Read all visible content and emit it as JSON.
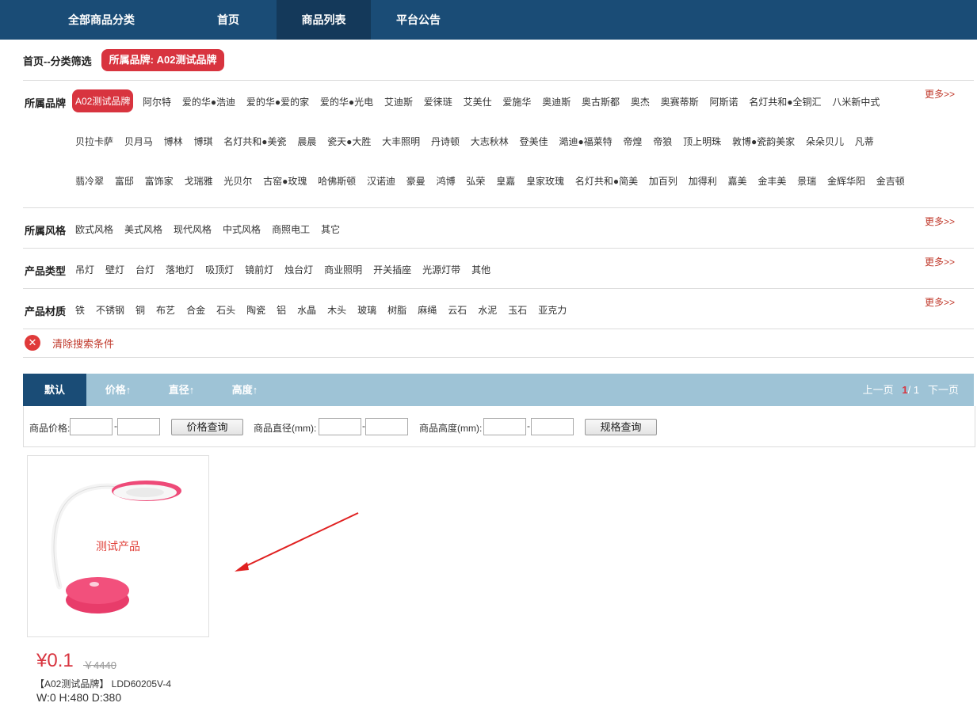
{
  "nav": {
    "items": [
      "全部商品分类",
      "首页",
      "商品列表",
      "平台公告"
    ],
    "active_index": 2
  },
  "breadcrumb": {
    "text": "首页--分类筛选",
    "tag": "所属品牌: A02测试品牌"
  },
  "filters": {
    "brand": {
      "label": "所属品牌",
      "selected": "A02测试品牌",
      "rows": [
        [
          "阿尔特",
          "爱的华●浩迪",
          "爱的华●爱的家",
          "爱的华●光电",
          "艾迪斯",
          "爱徕琏",
          "艾美仕",
          "爱施华",
          "奥迪斯",
          "奥古斯都",
          "奥杰",
          "奥赛蒂斯",
          "阿斯诺",
          "名灯共和●全铜汇",
          "八米新中式"
        ],
        [
          "贝拉卡萨",
          "贝月马",
          "博林",
          "博琪",
          "名灯共和●美瓷",
          "晨晨",
          "瓷天●大胜",
          "大丰照明",
          "丹诗顿",
          "大志秋林",
          "登美佳",
          "澔迪●福莱特",
          "帝煌",
          "帝狼",
          "顶上明珠",
          "敦博●瓷韵美家",
          "朵朵贝儿",
          "凡蒂"
        ],
        [
          "翡冷翠",
          "富邸",
          "富饰家",
          "戈瑞雅",
          "光贝尔",
          "古窑●玫瑰",
          "哈佛斯顿",
          "汉诺迪",
          "豪曼",
          "鸿博",
          "弘荣",
          "皇嘉",
          "皇家玫瑰",
          "名灯共和●简美",
          "加百列",
          "加得利",
          "嘉美",
          "金丰美",
          "景瑞",
          "金辉华阳",
          "金吉顿"
        ]
      ],
      "more": "更多>>"
    },
    "style": {
      "label": "所属风格",
      "options": [
        "欧式风格",
        "美式风格",
        "现代风格",
        "中式风格",
        "商照电工",
        "其它"
      ],
      "more": "更多>>"
    },
    "type": {
      "label": "产品类型",
      "options": [
        "吊灯",
        "壁灯",
        "台灯",
        "落地灯",
        "吸顶灯",
        "镜前灯",
        "烛台灯",
        "商业照明",
        "开关插座",
        "光源灯带",
        "其他"
      ],
      "more": "更多>>"
    },
    "material": {
      "label": "产品材质",
      "options": [
        "铁",
        "不锈钢",
        "铜",
        "布艺",
        "合金",
        "石头",
        "陶瓷",
        "铝",
        "水晶",
        "木头",
        "玻璃",
        "树脂",
        "麻绳",
        "云石",
        "水泥",
        "玉石",
        "亚克力"
      ],
      "more": "更多>>"
    },
    "clear": "清除搜索条件"
  },
  "sort": {
    "items": [
      "默认",
      "价格↑",
      "直径↑",
      "高度↑"
    ],
    "active_index": 0
  },
  "pager": {
    "prev": "上一页",
    "current": "1",
    "sep": "/",
    "total": "1",
    "next": "下一页"
  },
  "query": {
    "price_label": "商品价格:",
    "price_btn": "价格查询",
    "diameter_label": "商品直径(mm):",
    "height_label": "商品高度(mm):",
    "spec_btn": "规格查询",
    "dash": "-"
  },
  "product": {
    "overlay": "测试产品",
    "price": "¥0.1",
    "old_price": "￥4440",
    "name": "【A02测试品牌】 LDD60205V-4",
    "dims": "W:0 H:480 D:380"
  },
  "colors": {
    "nav_bg": "#1a4c76",
    "accent_red": "#d8343f",
    "sortbar_bg": "#9ec3d6",
    "lamp_pink": "#f0487a"
  }
}
